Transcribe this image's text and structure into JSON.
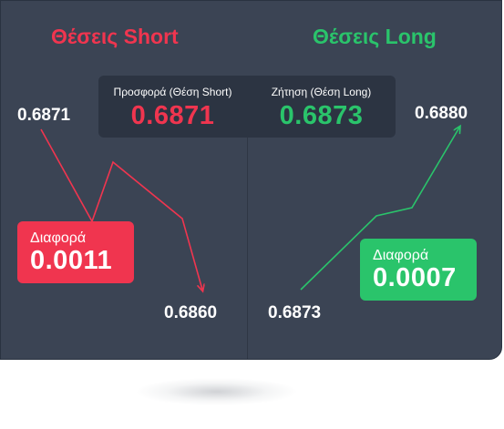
{
  "short": {
    "title": "Θέσεις Short",
    "start_price": "0.6871",
    "end_price": "0.6860",
    "diff_label": "Διαφορά",
    "diff_value": "0.0011",
    "color": "#f0354f"
  },
  "long": {
    "title": "Θέσεις Long",
    "start_price": "0.6873",
    "end_price": "0.6880",
    "diff_label": "Διαφορά",
    "diff_value": "0.0007",
    "color": "#2ac46b"
  },
  "quote": {
    "offer_label": "Προσφορά (Θέση Short)",
    "offer_value": "0.6871",
    "bid_label": "Ζήτηση (Θέση Long)",
    "bid_value": "0.6873"
  },
  "colors": {
    "panel": "#3b4454",
    "quote_box": "#2c3442",
    "red": "#f0354f",
    "green": "#2ac46b"
  },
  "icons": [
    "arrow-down-right-icon",
    "arrow-up-right-icon"
  ]
}
